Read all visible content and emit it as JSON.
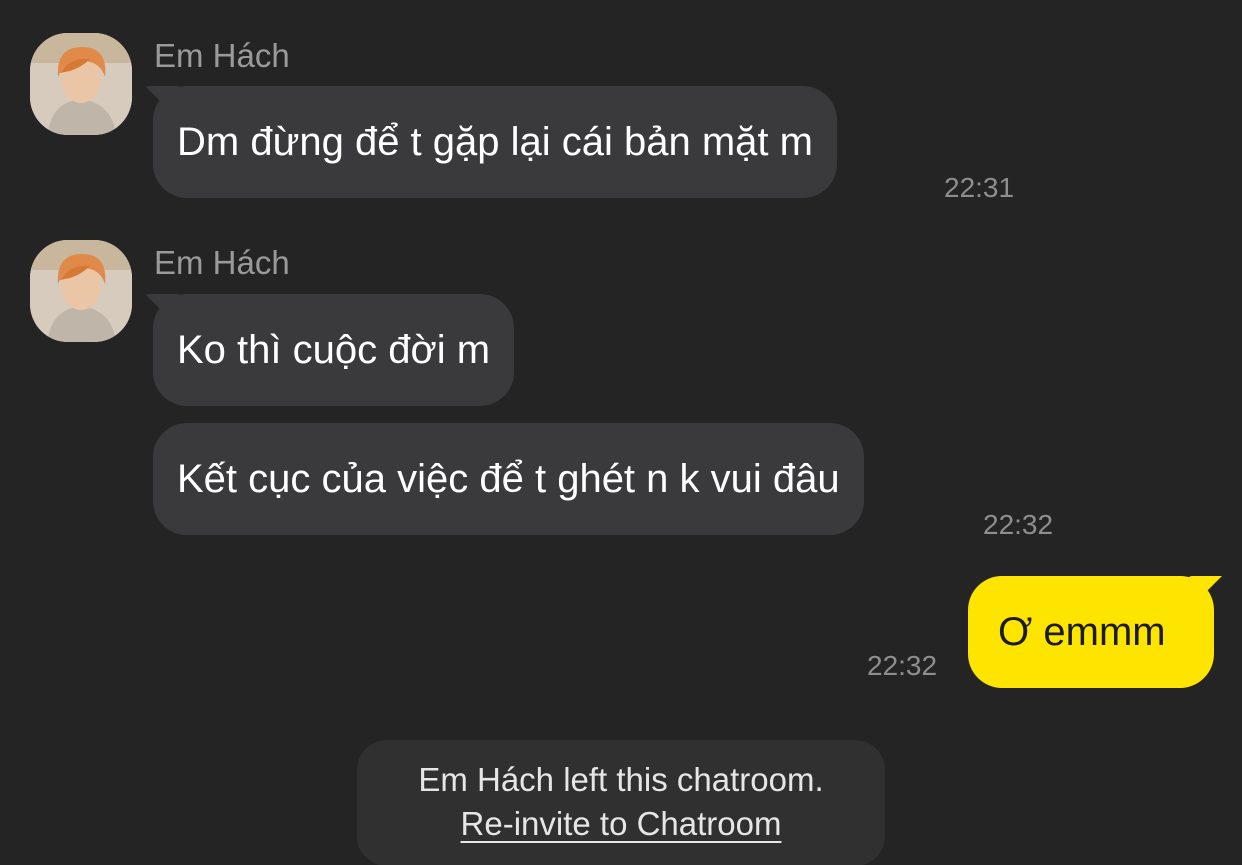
{
  "messages": [
    {
      "sender": "Em Hách",
      "text": "Dm đừng để t gặp lại cái bản mặt m",
      "time": "22:31"
    },
    {
      "sender": "Em Hách",
      "text": "Ko thì cuộc đời m"
    },
    {
      "text": "Kết cục của việc để t ghét n k vui đâu",
      "time": "22:32"
    },
    {
      "text": "Ơ emmm",
      "time": "22:32",
      "mine": true
    }
  ],
  "notice": {
    "text": "Em Hách left this chatroom.",
    "link": "Re-invite to Chatroom"
  },
  "colors": {
    "background": "#242424",
    "incoming_bubble": "#3a3a3c",
    "outgoing_bubble": "#fee500"
  },
  "icons": {
    "avatar": "profile-photo"
  }
}
